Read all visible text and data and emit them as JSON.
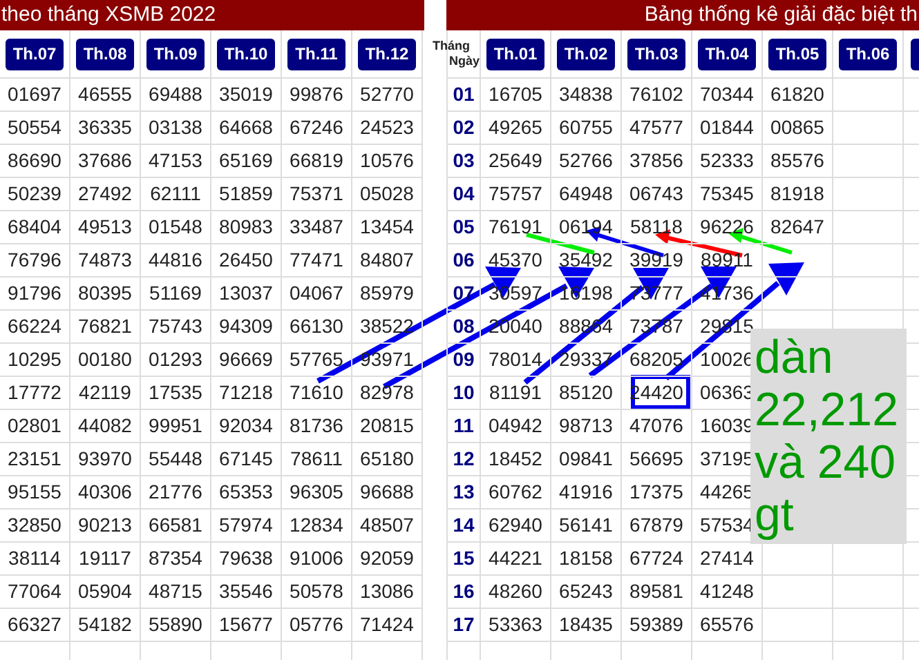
{
  "left_table": {
    "title": "theo tháng XSMB 2022",
    "columns": [
      "Th.07",
      "Th.08",
      "Th.09",
      "Th.10",
      "Th.11",
      "Th.12"
    ],
    "rows": [
      [
        "01697",
        "46555",
        "69488",
        "35019",
        "99876",
        "52770"
      ],
      [
        "50554",
        "36335",
        "03138",
        "64668",
        "67246",
        "24523"
      ],
      [
        "86690",
        "37686",
        "47153",
        "65169",
        "66819",
        "10576"
      ],
      [
        "50239",
        "27492",
        "62111",
        "51859",
        "75371",
        "05028"
      ],
      [
        "68404",
        "49513",
        "01548",
        "80983",
        "33487",
        "13454"
      ],
      [
        "76796",
        "74873",
        "44816",
        "26450",
        "77471",
        "84807"
      ],
      [
        "91796",
        "80395",
        "51169",
        "13037",
        "04067",
        "85979"
      ],
      [
        "66224",
        "76821",
        "75743",
        "94309",
        "66130",
        "38522"
      ],
      [
        "10295",
        "00180",
        "01293",
        "96669",
        "57765",
        "93971"
      ],
      [
        "17772",
        "42119",
        "17535",
        "71218",
        "71610",
        "82978"
      ],
      [
        "02801",
        "44082",
        "99951",
        "92034",
        "81736",
        "20815"
      ],
      [
        "23151",
        "93970",
        "55448",
        "67145",
        "78611",
        "65180"
      ],
      [
        "95155",
        "40306",
        "21776",
        "65353",
        "96305",
        "96688"
      ],
      [
        "32850",
        "90213",
        "66581",
        "57974",
        "12834",
        "48507"
      ],
      [
        "38114",
        "19117",
        "87354",
        "79638",
        "91006",
        "92059"
      ],
      [
        "77064",
        "05904",
        "48715",
        "35546",
        "50578",
        "13086"
      ],
      [
        "66327",
        "54182",
        "55890",
        "15677",
        "05776",
        "71424"
      ]
    ]
  },
  "right_table": {
    "title": "Bảng thống kê giải đặc biệt th",
    "corner_top": "Tháng",
    "corner_bottom": "Ngày",
    "columns": [
      "Th.01",
      "Th.02",
      "Th.03",
      "Th.04",
      "Th.05",
      "Th.06"
    ],
    "rows": [
      {
        "day": "01",
        "values": [
          "16705",
          "34838",
          "76102",
          "70344",
          "61820"
        ]
      },
      {
        "day": "02",
        "values": [
          "49265",
          "60755",
          "47577",
          "01844",
          "00865"
        ]
      },
      {
        "day": "03",
        "values": [
          "25649",
          "52766",
          "37856",
          "52333",
          "85576"
        ]
      },
      {
        "day": "04",
        "values": [
          "75757",
          "64948",
          "06743",
          "75345",
          "81918"
        ]
      },
      {
        "day": "05",
        "values": [
          "76191",
          "06194",
          "58118",
          "96226",
          "82647"
        ]
      },
      {
        "day": "06",
        "values": [
          "45370",
          "35492",
          "39919",
          "89911"
        ]
      },
      {
        "day": "07",
        "values": [
          "30597",
          "16198",
          "73777",
          "41736"
        ]
      },
      {
        "day": "08",
        "values": [
          "20040",
          "88864",
          "73787",
          "29815"
        ]
      },
      {
        "day": "09",
        "values": [
          "78014",
          "29337",
          "68205",
          "10026"
        ]
      },
      {
        "day": "10",
        "values": [
          "81191",
          "85120",
          "24420",
          "06363"
        ]
      },
      {
        "day": "11",
        "values": [
          "04942",
          "98713",
          "47076",
          "16039"
        ]
      },
      {
        "day": "12",
        "values": [
          "18452",
          "09841",
          "56695",
          "37195"
        ]
      },
      {
        "day": "13",
        "values": [
          "60762",
          "41916",
          "17375",
          "44265"
        ]
      },
      {
        "day": "14",
        "values": [
          "62940",
          "56141",
          "67879",
          "57534"
        ]
      },
      {
        "day": "15",
        "values": [
          "44221",
          "18158",
          "67724",
          "27414"
        ]
      },
      {
        "day": "16",
        "values": [
          "48260",
          "65243",
          "89581",
          "41248"
        ]
      },
      {
        "day": "17",
        "values": [
          "53363",
          "18435",
          "59389",
          "65576"
        ]
      }
    ]
  },
  "note": {
    "text": "dàn 22,212 và 240 gt"
  }
}
